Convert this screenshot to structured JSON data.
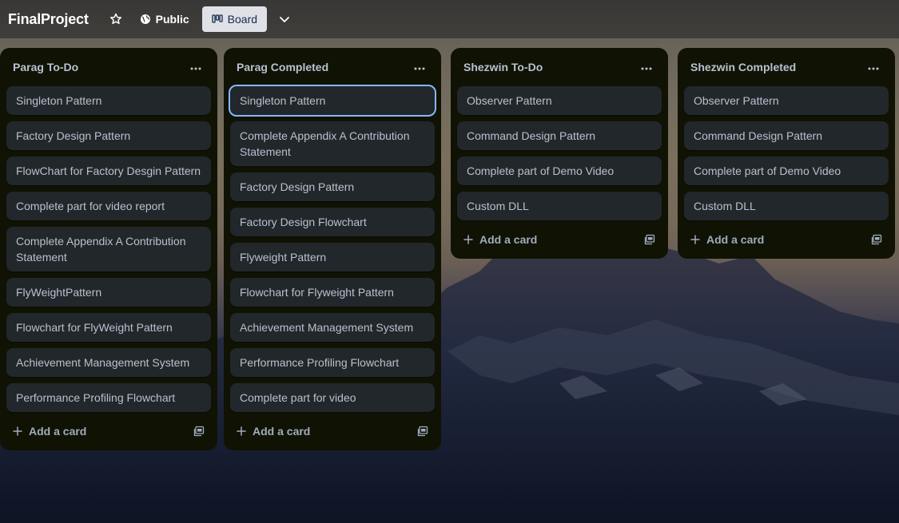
{
  "header": {
    "board_title": "FinalProject",
    "star_icon": "star-outline-icon",
    "visibility_label": "Public",
    "visibility_icon": "globe-icon",
    "view_label": "Board",
    "view_icon": "board-icon",
    "more_views_icon": "chevron-down-icon"
  },
  "colors": {
    "list_bg": "#101204",
    "card_bg": "#22272b",
    "card_text": "#b6c2cf",
    "selected_outline": "#85b8ff",
    "view_button_bg": "#dfe1e6"
  },
  "lists": [
    {
      "title": "Parag To-Do",
      "menu": "···",
      "cards": [
        "Singleton Pattern",
        "Factory Design Pattern",
        "FlowChart for Factory Desgin Pattern",
        "Complete part for video report",
        "Complete Appendix A Contribution Statement",
        "FlyWeightPattern",
        "Flowchart for FlyWeight Pattern",
        "Achievement Management System",
        "Performance Profiling Flowchart"
      ],
      "add_label": "Add a card"
    },
    {
      "title": "Parag Completed",
      "menu": "···",
      "cards": [
        "Singleton Pattern",
        "Complete Appendix A Contribution Statement",
        "Factory Design Pattern",
        "Factory Design Flowchart",
        "Flyweight Pattern",
        "Flowchart for Flyweight Pattern",
        "Achievement Management System",
        "Performance Profiling Flowchart",
        "Complete part for video"
      ],
      "add_label": "Add a card"
    },
    {
      "title": "Shezwin To-Do",
      "menu": "···",
      "cards": [
        "Observer Pattern",
        "Command Design Pattern",
        "Complete part of Demo Video",
        "Custom DLL"
      ],
      "add_label": "Add a card"
    },
    {
      "title": "Shezwin Completed",
      "menu": "···",
      "cards": [
        "Observer Pattern",
        "Command Design Pattern",
        "Complete part of Demo Video",
        "Custom DLL"
      ],
      "add_label": "Add a card"
    }
  ],
  "add_card_icon": "plus-icon",
  "template_icon": "card-template-icon",
  "selected_card": {
    "list": 1,
    "card": 0
  }
}
